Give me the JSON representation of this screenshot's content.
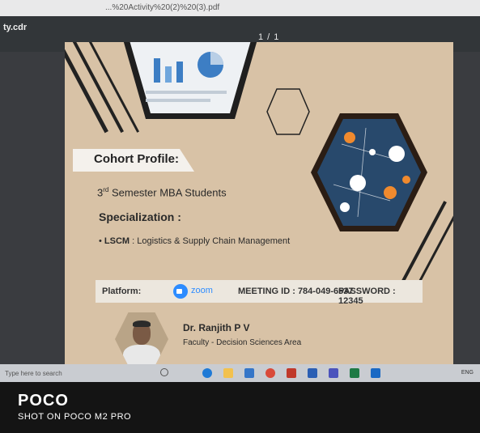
{
  "browser": {
    "url_fragment": "...%20Activity%20(2)%20(3).pdf",
    "file_name": "ty.cdr",
    "page_indicator": "1 / 1"
  },
  "slide": {
    "banner_title": "Cohort Profile:",
    "semester_num": "3",
    "semester_sup": "rd",
    "semester_rest": " Semester MBA Students",
    "specialization_label": "Specialization :",
    "lscm_bullet": "•",
    "lscm_label": "LSCM",
    "lscm_desc": " : Logistics & Supply Chain Management",
    "platform_label": "Platform:",
    "zoom_word": "zoom",
    "meeting_id": "MEETING ID : 784-049-6537",
    "password": "PASSWORD : 12345",
    "faculty_name": "Dr. Ranjith P V",
    "faculty_role": "Faculty - Decision Sciences Area"
  },
  "taskbar": {
    "search_placeholder": "Type here to search",
    "tray_text": "ENG"
  },
  "watermark": {
    "brand": "POCO",
    "subtitle": "SHOT ON POCO M2 PRO"
  },
  "colors": {
    "page_bg": "#d8c2a6",
    "accent_dark": "#222222",
    "zoom_blue": "#2d8cff"
  }
}
